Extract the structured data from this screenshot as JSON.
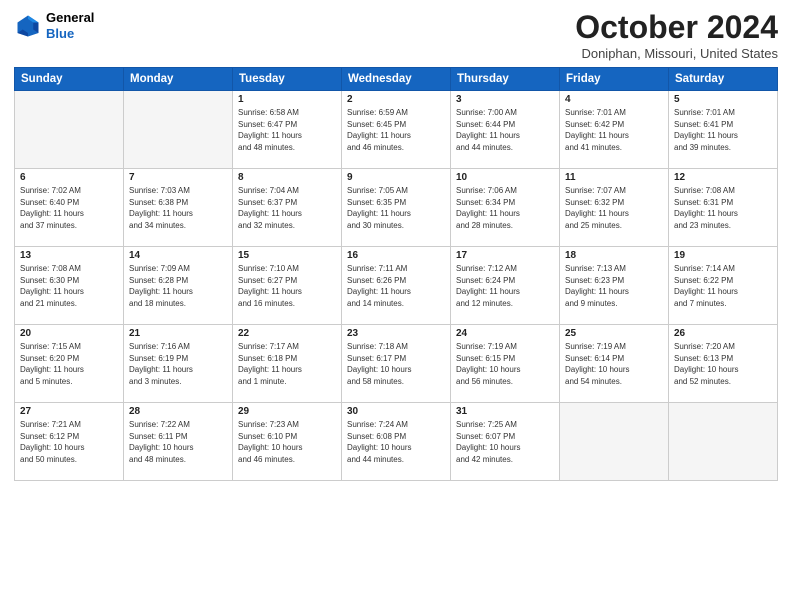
{
  "header": {
    "logo_line1": "General",
    "logo_line2": "Blue",
    "month": "October 2024",
    "location": "Doniphan, Missouri, United States"
  },
  "weekdays": [
    "Sunday",
    "Monday",
    "Tuesday",
    "Wednesday",
    "Thursday",
    "Friday",
    "Saturday"
  ],
  "weeks": [
    [
      {
        "num": "",
        "info": ""
      },
      {
        "num": "",
        "info": ""
      },
      {
        "num": "1",
        "info": "Sunrise: 6:58 AM\nSunset: 6:47 PM\nDaylight: 11 hours\nand 48 minutes."
      },
      {
        "num": "2",
        "info": "Sunrise: 6:59 AM\nSunset: 6:45 PM\nDaylight: 11 hours\nand 46 minutes."
      },
      {
        "num": "3",
        "info": "Sunrise: 7:00 AM\nSunset: 6:44 PM\nDaylight: 11 hours\nand 44 minutes."
      },
      {
        "num": "4",
        "info": "Sunrise: 7:01 AM\nSunset: 6:42 PM\nDaylight: 11 hours\nand 41 minutes."
      },
      {
        "num": "5",
        "info": "Sunrise: 7:01 AM\nSunset: 6:41 PM\nDaylight: 11 hours\nand 39 minutes."
      }
    ],
    [
      {
        "num": "6",
        "info": "Sunrise: 7:02 AM\nSunset: 6:40 PM\nDaylight: 11 hours\nand 37 minutes."
      },
      {
        "num": "7",
        "info": "Sunrise: 7:03 AM\nSunset: 6:38 PM\nDaylight: 11 hours\nand 34 minutes."
      },
      {
        "num": "8",
        "info": "Sunrise: 7:04 AM\nSunset: 6:37 PM\nDaylight: 11 hours\nand 32 minutes."
      },
      {
        "num": "9",
        "info": "Sunrise: 7:05 AM\nSunset: 6:35 PM\nDaylight: 11 hours\nand 30 minutes."
      },
      {
        "num": "10",
        "info": "Sunrise: 7:06 AM\nSunset: 6:34 PM\nDaylight: 11 hours\nand 28 minutes."
      },
      {
        "num": "11",
        "info": "Sunrise: 7:07 AM\nSunset: 6:32 PM\nDaylight: 11 hours\nand 25 minutes."
      },
      {
        "num": "12",
        "info": "Sunrise: 7:08 AM\nSunset: 6:31 PM\nDaylight: 11 hours\nand 23 minutes."
      }
    ],
    [
      {
        "num": "13",
        "info": "Sunrise: 7:08 AM\nSunset: 6:30 PM\nDaylight: 11 hours\nand 21 minutes."
      },
      {
        "num": "14",
        "info": "Sunrise: 7:09 AM\nSunset: 6:28 PM\nDaylight: 11 hours\nand 18 minutes."
      },
      {
        "num": "15",
        "info": "Sunrise: 7:10 AM\nSunset: 6:27 PM\nDaylight: 11 hours\nand 16 minutes."
      },
      {
        "num": "16",
        "info": "Sunrise: 7:11 AM\nSunset: 6:26 PM\nDaylight: 11 hours\nand 14 minutes."
      },
      {
        "num": "17",
        "info": "Sunrise: 7:12 AM\nSunset: 6:24 PM\nDaylight: 11 hours\nand 12 minutes."
      },
      {
        "num": "18",
        "info": "Sunrise: 7:13 AM\nSunset: 6:23 PM\nDaylight: 11 hours\nand 9 minutes."
      },
      {
        "num": "19",
        "info": "Sunrise: 7:14 AM\nSunset: 6:22 PM\nDaylight: 11 hours\nand 7 minutes."
      }
    ],
    [
      {
        "num": "20",
        "info": "Sunrise: 7:15 AM\nSunset: 6:20 PM\nDaylight: 11 hours\nand 5 minutes."
      },
      {
        "num": "21",
        "info": "Sunrise: 7:16 AM\nSunset: 6:19 PM\nDaylight: 11 hours\nand 3 minutes."
      },
      {
        "num": "22",
        "info": "Sunrise: 7:17 AM\nSunset: 6:18 PM\nDaylight: 11 hours\nand 1 minute."
      },
      {
        "num": "23",
        "info": "Sunrise: 7:18 AM\nSunset: 6:17 PM\nDaylight: 10 hours\nand 58 minutes."
      },
      {
        "num": "24",
        "info": "Sunrise: 7:19 AM\nSunset: 6:15 PM\nDaylight: 10 hours\nand 56 minutes."
      },
      {
        "num": "25",
        "info": "Sunrise: 7:19 AM\nSunset: 6:14 PM\nDaylight: 10 hours\nand 54 minutes."
      },
      {
        "num": "26",
        "info": "Sunrise: 7:20 AM\nSunset: 6:13 PM\nDaylight: 10 hours\nand 52 minutes."
      }
    ],
    [
      {
        "num": "27",
        "info": "Sunrise: 7:21 AM\nSunset: 6:12 PM\nDaylight: 10 hours\nand 50 minutes."
      },
      {
        "num": "28",
        "info": "Sunrise: 7:22 AM\nSunset: 6:11 PM\nDaylight: 10 hours\nand 48 minutes."
      },
      {
        "num": "29",
        "info": "Sunrise: 7:23 AM\nSunset: 6:10 PM\nDaylight: 10 hours\nand 46 minutes."
      },
      {
        "num": "30",
        "info": "Sunrise: 7:24 AM\nSunset: 6:08 PM\nDaylight: 10 hours\nand 44 minutes."
      },
      {
        "num": "31",
        "info": "Sunrise: 7:25 AM\nSunset: 6:07 PM\nDaylight: 10 hours\nand 42 minutes."
      },
      {
        "num": "",
        "info": ""
      },
      {
        "num": "",
        "info": ""
      }
    ]
  ]
}
